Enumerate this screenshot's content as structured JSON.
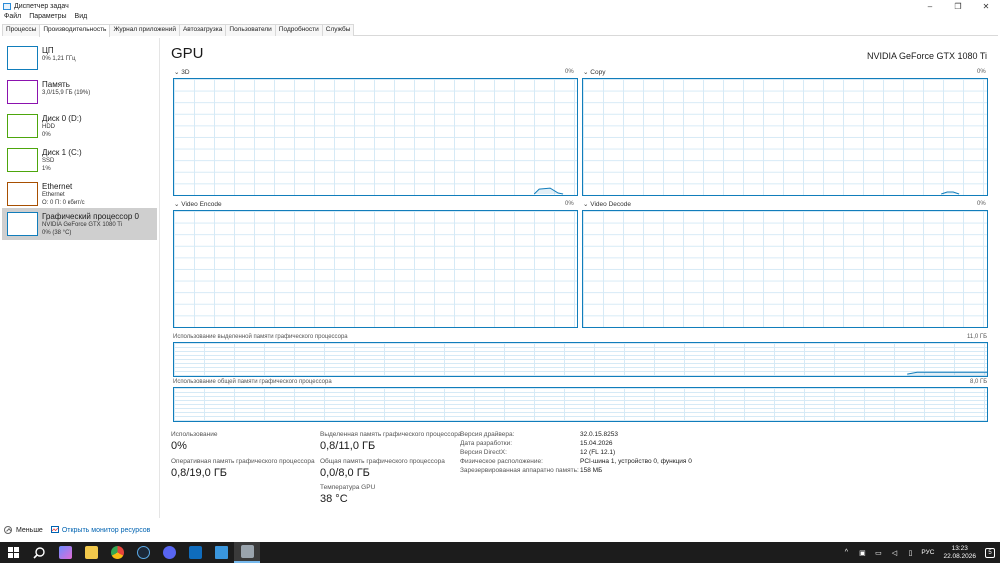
{
  "window": {
    "title": "Диспетчер задач",
    "controls": [
      "–",
      "❐",
      "✕"
    ]
  },
  "menu": [
    "Файл",
    "Параметры",
    "Вид"
  ],
  "tabs": [
    {
      "label": "Процессы",
      "active": false
    },
    {
      "label": "Производительность",
      "active": true
    },
    {
      "label": "Журнал приложений",
      "active": false
    },
    {
      "label": "Автозагрузка",
      "active": false
    },
    {
      "label": "Пользователи",
      "active": false
    },
    {
      "label": "Подробности",
      "active": false
    },
    {
      "label": "Службы",
      "active": false
    }
  ],
  "sidebar": {
    "items": [
      {
        "title": "ЦП",
        "lines": [
          "0% 1,21 ГГц"
        ],
        "color": "#117dbb",
        "active": false
      },
      {
        "title": "Память",
        "lines": [
          "3,0/15,9 ГБ (19%)"
        ],
        "color": "#8b12ae",
        "active": false
      },
      {
        "title": "Диск 0 (D:)",
        "lines": [
          "HDD",
          "0%"
        ],
        "color": "#4da60c",
        "active": false
      },
      {
        "title": "Диск 1 (C:)",
        "lines": [
          "SSD",
          "1%"
        ],
        "color": "#4da60c",
        "active": false
      },
      {
        "title": "Ethernet",
        "lines": [
          "Ethernet",
          "О: 0 П: 0 кбит/с"
        ],
        "color": "#a74f01",
        "active": false
      },
      {
        "title": "Графический процессор 0",
        "lines": [
          "NVIDIA GeForce GTX 1080 Ti",
          "0% (38 °C)"
        ],
        "color": "#117dbb",
        "active": true
      }
    ]
  },
  "main": {
    "title": "GPU",
    "model": "NVIDIA GeForce GTX 1080 Ti",
    "engines": [
      {
        "name": "3D",
        "value": "0%"
      },
      {
        "name": "Copy",
        "value": "0%"
      },
      {
        "name": "Video Encode",
        "value": "0%"
      },
      {
        "name": "Video Decode",
        "value": "0%"
      }
    ],
    "dedicated_memory": {
      "label": "Использование выделенной памяти графического процессора",
      "max": "11,0 ГБ"
    },
    "shared_memory": {
      "label": "Использование общей памяти графического процессора",
      "max": "8,0 ГБ"
    },
    "stats": {
      "utilization_label": "Использование",
      "utilization_value": "0%",
      "ram_label": "Оперативная память графического процессора",
      "ram_value": "0,8/19,0 ГБ",
      "dedicated_label": "Выделенная память графического процессора",
      "dedicated_value": "0,8/11,0 ГБ",
      "shared_label": "Общая память графического процессора",
      "shared_value": "0,0/8,0 ГБ",
      "temp_label": "Температура GPU",
      "temp_value": "38 °C"
    },
    "properties": [
      {
        "label": "Версия драйвера:",
        "value": "32.0.15.8253"
      },
      {
        "label": "Дата разработки:",
        "value": "15.04.2026"
      },
      {
        "label": "Версия DirectX:",
        "value": "12 (FL 12.1)"
      },
      {
        "label": "Физическое расположение:",
        "value": "PCI-шина 1, устройство 0, функция 0"
      },
      {
        "label": "Зарезервированная аппаратно память:",
        "value": "158 МБ"
      }
    ]
  },
  "footer": {
    "fewer_details": "Меньше",
    "open_monitor": "Открыть монитор ресурсов"
  },
  "taskbar": {
    "apps": [
      {
        "name": "start",
        "color": "#ffffff"
      },
      {
        "name": "search",
        "color": "#ffffff"
      },
      {
        "name": "copilot",
        "color": "#6b8cff"
      },
      {
        "name": "file-explorer",
        "color": "#f2c94c"
      },
      {
        "name": "chrome",
        "color": "#e8453c"
      },
      {
        "name": "steam",
        "color": "#5aa9e6"
      },
      {
        "name": "discord",
        "color": "#5865f2"
      },
      {
        "name": "outlook",
        "color": "#0f6cbd"
      },
      {
        "name": "remote-desktop",
        "color": "#3a96dd"
      },
      {
        "name": "task-manager",
        "color": "#9aa4ad"
      }
    ],
    "language": "РУС",
    "time": "13:23",
    "date": "22.08.2026",
    "notifications": "5"
  }
}
